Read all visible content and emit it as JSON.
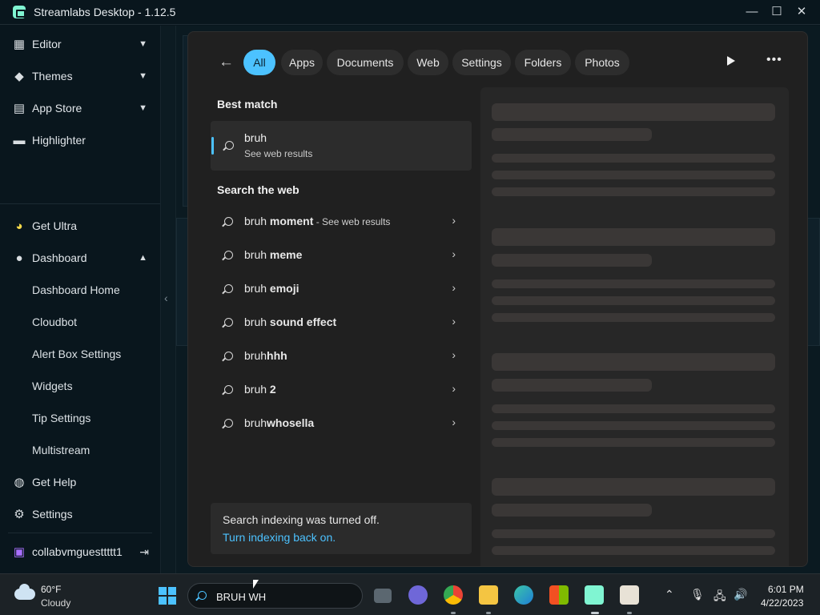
{
  "window": {
    "title": "Streamlabs Desktop - 1.12.5",
    "controls": [
      "—",
      "☐",
      "✕"
    ]
  },
  "sidebar": {
    "items": [
      {
        "label": "Editor",
        "icon": "editor-icon"
      },
      {
        "label": "Themes",
        "icon": "paint-bucket-icon"
      },
      {
        "label": "App Store",
        "icon": "store-icon"
      },
      {
        "label": "Highlighter",
        "icon": "clapperboard-icon"
      }
    ],
    "bottom": [
      {
        "label": "Get Ultra",
        "icon": "ultra-icon"
      },
      {
        "label": "Dashboard",
        "icon": "dashboard-icon"
      }
    ],
    "dashboard_sub": [
      "Dashboard Home",
      "Cloudbot",
      "Alert Box Settings",
      "Widgets",
      "Tip Settings",
      "Multistream"
    ],
    "help": "Get Help",
    "settings": "Settings",
    "user": "collabvmguesttttt1"
  },
  "search": {
    "tabs": [
      "All",
      "Apps",
      "Documents",
      "Web",
      "Settings",
      "Folders",
      "Photos"
    ],
    "best_match_heading": "Best match",
    "best_match": {
      "query": "bruh",
      "sub": "See web results"
    },
    "web_heading": "Search the web",
    "web_results": [
      {
        "pre": "bruh ",
        "bold": "moment",
        "suffix": " - See web results"
      },
      {
        "pre": "bruh ",
        "bold": "meme",
        "suffix": ""
      },
      {
        "pre": "bruh ",
        "bold": "emoji",
        "suffix": ""
      },
      {
        "pre": "bruh ",
        "bold": "sound effect",
        "suffix": ""
      },
      {
        "pre": "bruh",
        "bold": "hhh",
        "suffix": ""
      },
      {
        "pre": "bruh ",
        "bold": "2",
        "suffix": ""
      },
      {
        "pre": "bruh",
        "bold": "whosella",
        "suffix": ""
      }
    ],
    "indexing_text": "Search indexing was turned off.",
    "indexing_link": "Turn indexing back on."
  },
  "taskbar": {
    "weather": {
      "temp": "60°F",
      "condition": "Cloudy"
    },
    "search_value": "BRUH WH",
    "time": "6:01 PM",
    "date": "4/22/2023"
  }
}
